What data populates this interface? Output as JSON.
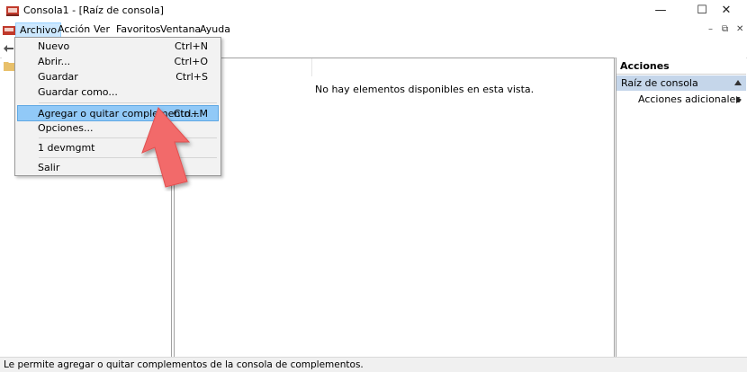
{
  "window": {
    "title": "Consola1 - [Raíz de consola]",
    "controls": {
      "minimize": "—",
      "maximize": "☐",
      "close": "✕"
    }
  },
  "menubar": {
    "items": [
      "Archivo",
      "Acción",
      "Ver",
      "Favoritos",
      "Ventana",
      "Ayuda"
    ],
    "mdi": {
      "minimize": "–",
      "restore": "⧉",
      "close": "✕"
    }
  },
  "dropdown": {
    "items": [
      {
        "label": "Nuevo",
        "shortcut": "Ctrl+N"
      },
      {
        "label": "Abrir...",
        "shortcut": "Ctrl+O"
      },
      {
        "label": "Guardar",
        "shortcut": "Ctrl+S"
      },
      {
        "label": "Guardar como...",
        "shortcut": ""
      },
      {
        "label": "Agregar o quitar complemento...",
        "shortcut": "Ctrl+M"
      },
      {
        "label": "Opciones...",
        "shortcut": ""
      },
      {
        "label": "1 devmgmt",
        "shortcut": ""
      },
      {
        "label": "Salir",
        "shortcut": ""
      }
    ]
  },
  "center": {
    "empty_message": "No hay elementos disponibles en esta vista."
  },
  "actions": {
    "title": "Acciones",
    "section": "Raíz de consola",
    "more": "Acciones adicionales"
  },
  "status": {
    "text": "Le permite agregar o quitar complementos de la consola de complementos."
  },
  "colors": {
    "highlight": "#91c9f7",
    "section": "#c5d6ea",
    "arrow": "#f26b6b"
  }
}
